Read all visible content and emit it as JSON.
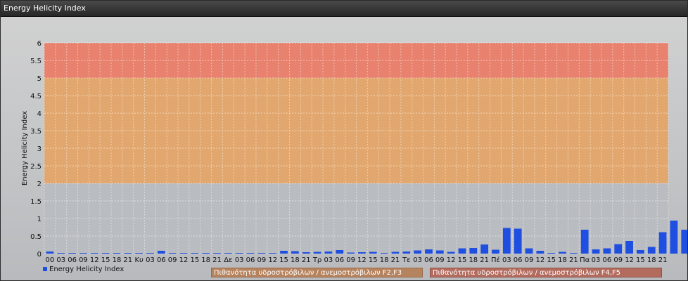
{
  "window": {
    "title": "Energy Helicity Index"
  },
  "chart_data": {
    "type": "bar",
    "title": "",
    "ylabel": "Energy Helicity Index",
    "xlabel": "",
    "ylim": [
      0,
      6
    ],
    "yticks": [
      "0",
      "0.5",
      "1",
      "1.5",
      "2",
      "2.5",
      "3",
      "3.5",
      "4",
      "4.5",
      "5",
      "5.5",
      "6"
    ],
    "grid": true,
    "bands": [
      {
        "from": 0,
        "to": 2,
        "color": "#b9bcc0"
      },
      {
        "from": 2,
        "to": 5,
        "color": "#e2a76e"
      },
      {
        "from": 5,
        "to": 6,
        "color": "#e8826e"
      }
    ],
    "categories": [
      "00",
      "03",
      "06",
      "09",
      "12",
      "15",
      "18",
      "21",
      "Κυ",
      "03",
      "06",
      "09",
      "12",
      "15",
      "18",
      "21",
      "Δε",
      "03",
      "06",
      "09",
      "12",
      "15",
      "18",
      "21",
      "Τρ",
      "03",
      "06",
      "09",
      "12",
      "15",
      "18",
      "21",
      "Τε",
      "03",
      "06",
      "09",
      "12",
      "15",
      "18",
      "21",
      "Πέ",
      "03",
      "06",
      "09",
      "12",
      "15",
      "18",
      "21",
      "Πα",
      "03",
      "06",
      "09",
      "12",
      "15",
      "18",
      "21"
    ],
    "series": [
      {
        "name": "Energy Helicity Index",
        "color": "#1f4fe0",
        "values": [
          0.06,
          0.02,
          0.02,
          0.02,
          0.02,
          0.02,
          0.02,
          0.02,
          0.02,
          0.02,
          0.08,
          0.02,
          0.02,
          0.02,
          0.02,
          0.02,
          0.02,
          0.02,
          0.02,
          0.02,
          0.02,
          0.08,
          0.07,
          0.04,
          0.05,
          0.06,
          0.1,
          0.03,
          0.04,
          0.05,
          0.02,
          0.05,
          0.06,
          0.09,
          0.12,
          0.09,
          0.05,
          0.15,
          0.16,
          0.26,
          0.11,
          0.73,
          0.71,
          0.15,
          0.08,
          0.02,
          0.05,
          0.02,
          0.68,
          0.12,
          0.15,
          0.27,
          0.36,
          0.1,
          0.19,
          0.61,
          0.94,
          0.68
        ]
      }
    ],
    "legend": {
      "series_label": "Energy Helicity Index",
      "band_labels": [
        {
          "label": "Πιθανότητα υδροστρόβιλων / ανεμοστρόβιλων F2,F3",
          "color": "#b6835f"
        },
        {
          "label": "Πιθανότητα υδροστρόβιλων / ανεμοστρόβιλων F4,F5",
          "color": "#b36b5e"
        }
      ]
    }
  }
}
